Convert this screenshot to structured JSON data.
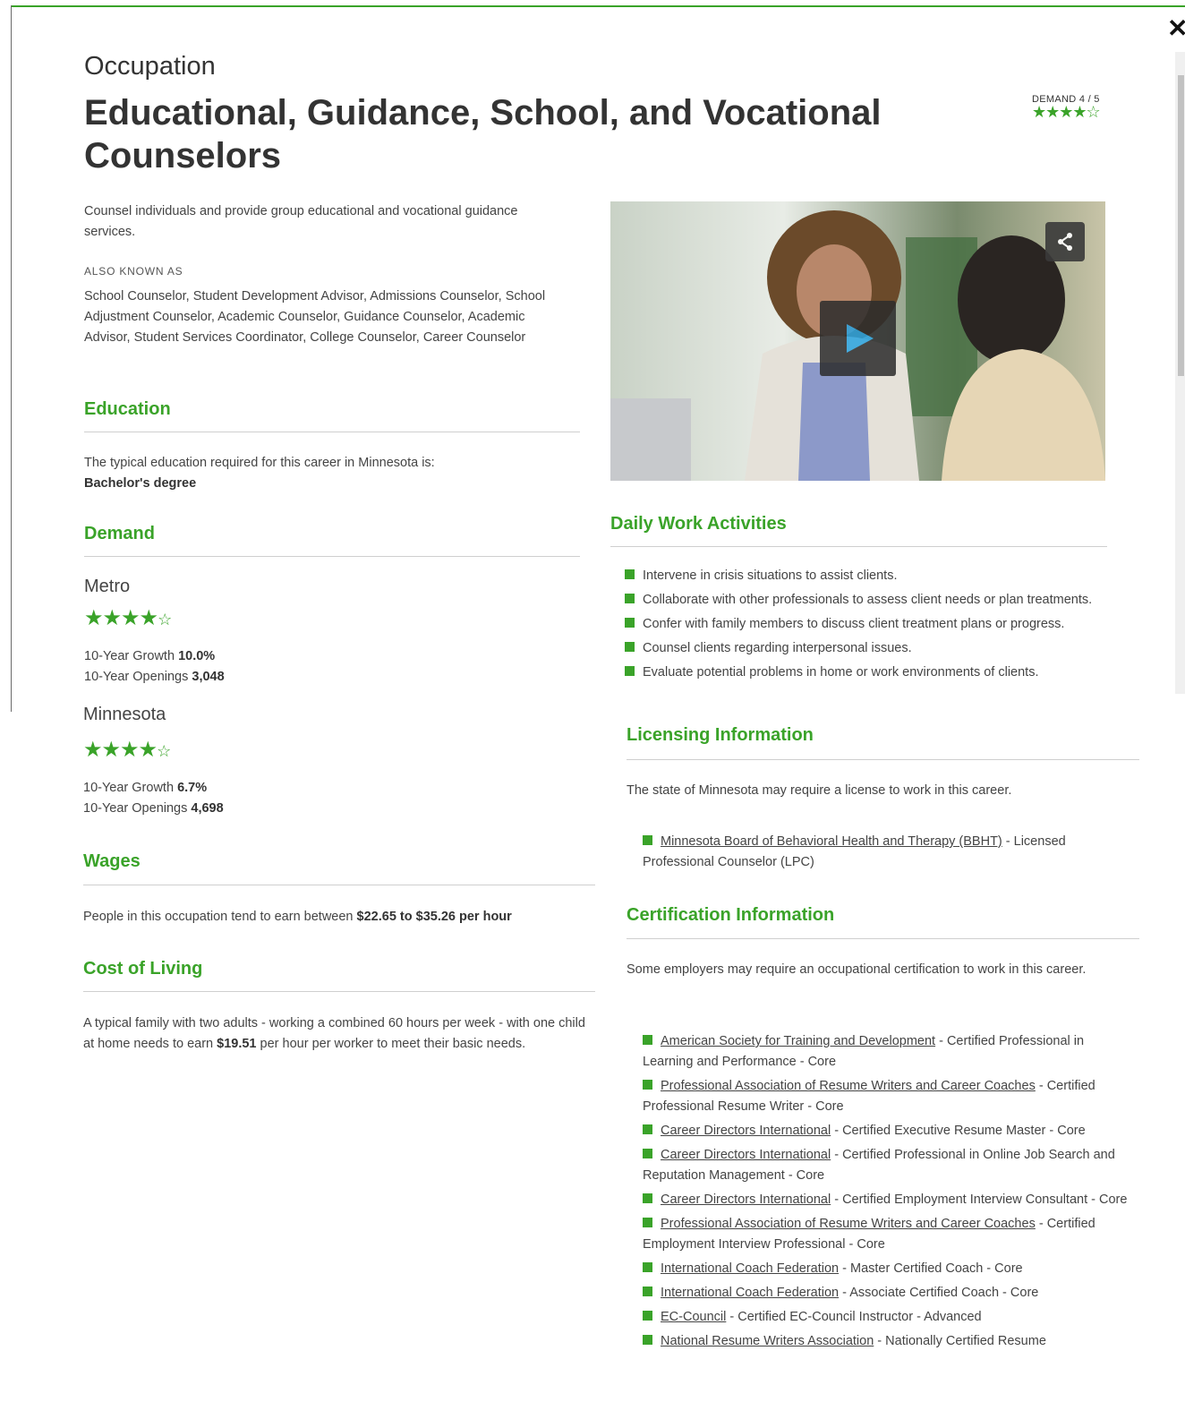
{
  "header": {
    "kicker": "Occupation",
    "title": "Educational, Guidance, School, and Vocational Counselors",
    "demand_label": "DEMAND 4 / 5",
    "demand_stars": "★★★★☆"
  },
  "intro": {
    "description": "Counsel individuals and provide group educational and vocational guidance services.",
    "aka_label": "ALSO KNOWN AS",
    "aka_list": "School Counselor, Student Development Advisor, Admissions Counselor, School Adjustment Counselor, Academic Counselor, Guidance Counselor, Academic Advisor, Student Services Coordinator, College Counselor, Career Counselor"
  },
  "education": {
    "heading": "Education",
    "text": "The typical education required for this career in Minnesota is:",
    "value": "Bachelor's degree"
  },
  "demand": {
    "heading": "Demand",
    "regions": [
      {
        "name": "Metro",
        "stars": "★★★★",
        "empty_star": "☆",
        "growth_label": "10-Year Growth",
        "growth_value": "10.0%",
        "openings_label": "10-Year Openings",
        "openings_value": "3,048"
      },
      {
        "name": "Minnesota",
        "stars": "★★★★",
        "empty_star": "☆",
        "growth_label": "10-Year Growth",
        "growth_value": "6.7%",
        "openings_label": "10-Year Openings",
        "openings_value": "4,698"
      }
    ]
  },
  "wages": {
    "heading": "Wages",
    "text_before": "People in this occupation tend to earn between",
    "range": "$22.65 to $35.26 per hour"
  },
  "cost_of_living": {
    "heading": "Cost of Living",
    "text_before": "A typical family with two adults - working a combined 60 hours per week - with one child at home needs to earn",
    "amount": "$19.51",
    "text_after": "per hour per worker to meet their basic needs."
  },
  "daily": {
    "heading": "Daily Work Activities",
    "items": [
      "Intervene in crisis situations to assist clients.",
      "Collaborate with other professionals to assess client needs or plan treatments.",
      "Confer with family members to discuss client treatment plans or progress.",
      "Counsel clients regarding interpersonal issues.",
      "Evaluate potential problems in home or work environments of clients."
    ]
  },
  "licensing": {
    "heading": "Licensing Information",
    "text": "The state of Minnesota may require a license to work in this career.",
    "items": [
      {
        "link": "Minnesota Board of Behavioral Health and Therapy (BBHT)",
        "rest": " - Licensed Professional Counselor (LPC)"
      }
    ]
  },
  "certification": {
    "heading": "Certification Information",
    "text": "Some employers may require an occupational certification to work in this career.",
    "items": [
      {
        "link": "American Society for Training and Development",
        "rest": " - Certified Professional in Learning and Performance - Core"
      },
      {
        "link": "Professional Association of Resume Writers and Career Coaches",
        "rest": " - Certified Professional Resume Writer - Core"
      },
      {
        "link": "Career Directors International",
        "rest": " - Certified Executive Resume Master - Core"
      },
      {
        "link": "Career Directors International",
        "rest": " - Certified Professional in Online Job Search and Reputation Management - Core"
      },
      {
        "link": "Career Directors International",
        "rest": " - Certified Employment Interview Consultant - Core"
      },
      {
        "link": "Professional Association of Resume Writers and Career Coaches",
        "rest": " - Certified Employment Interview Professional - Core"
      },
      {
        "link": "International Coach Federation",
        "rest": " - Master Certified Coach - Core"
      },
      {
        "link": "International Coach Federation",
        "rest": " - Associate Certified Coach - Core"
      },
      {
        "link": "EC-Council",
        "rest": " - Certified EC-Council Instructor - Advanced"
      },
      {
        "link": "National Resume Writers Association",
        "rest": " - Nationally Certified Resume"
      }
    ]
  },
  "icons": {
    "close": "close-icon",
    "share": "share-icon",
    "play": "play-icon",
    "bullet": "green-square-bullet"
  },
  "colors": {
    "accent": "#3aa329",
    "text": "#444444",
    "heading": "#333333"
  }
}
